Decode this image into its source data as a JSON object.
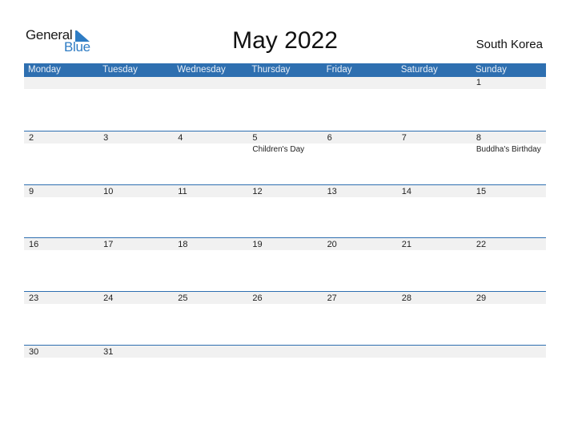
{
  "logo": {
    "line1": "General",
    "line2": "Blue"
  },
  "title": "May 2022",
  "country": "South Korea",
  "colors": {
    "header_bg": "#2e6fb0",
    "accent": "#2e7cc4",
    "daybar_bg": "#f1f1f1"
  },
  "weekdays": [
    "Monday",
    "Tuesday",
    "Wednesday",
    "Thursday",
    "Friday",
    "Saturday",
    "Sunday"
  ],
  "weeks": [
    {
      "days": [
        {
          "num": "",
          "event": ""
        },
        {
          "num": "",
          "event": ""
        },
        {
          "num": "",
          "event": ""
        },
        {
          "num": "",
          "event": ""
        },
        {
          "num": "",
          "event": ""
        },
        {
          "num": "",
          "event": ""
        },
        {
          "num": "1",
          "event": ""
        }
      ]
    },
    {
      "days": [
        {
          "num": "2",
          "event": ""
        },
        {
          "num": "3",
          "event": ""
        },
        {
          "num": "4",
          "event": ""
        },
        {
          "num": "5",
          "event": "Children's Day"
        },
        {
          "num": "6",
          "event": ""
        },
        {
          "num": "7",
          "event": ""
        },
        {
          "num": "8",
          "event": "Buddha's Birthday"
        }
      ]
    },
    {
      "days": [
        {
          "num": "9",
          "event": ""
        },
        {
          "num": "10",
          "event": ""
        },
        {
          "num": "11",
          "event": ""
        },
        {
          "num": "12",
          "event": ""
        },
        {
          "num": "13",
          "event": ""
        },
        {
          "num": "14",
          "event": ""
        },
        {
          "num": "15",
          "event": ""
        }
      ]
    },
    {
      "days": [
        {
          "num": "16",
          "event": ""
        },
        {
          "num": "17",
          "event": ""
        },
        {
          "num": "18",
          "event": ""
        },
        {
          "num": "19",
          "event": ""
        },
        {
          "num": "20",
          "event": ""
        },
        {
          "num": "21",
          "event": ""
        },
        {
          "num": "22",
          "event": ""
        }
      ]
    },
    {
      "days": [
        {
          "num": "23",
          "event": ""
        },
        {
          "num": "24",
          "event": ""
        },
        {
          "num": "25",
          "event": ""
        },
        {
          "num": "26",
          "event": ""
        },
        {
          "num": "27",
          "event": ""
        },
        {
          "num": "28",
          "event": ""
        },
        {
          "num": "29",
          "event": ""
        }
      ]
    },
    {
      "days": [
        {
          "num": "30",
          "event": ""
        },
        {
          "num": "31",
          "event": ""
        },
        {
          "num": "",
          "event": ""
        },
        {
          "num": "",
          "event": ""
        },
        {
          "num": "",
          "event": ""
        },
        {
          "num": "",
          "event": ""
        },
        {
          "num": "",
          "event": ""
        }
      ]
    }
  ]
}
